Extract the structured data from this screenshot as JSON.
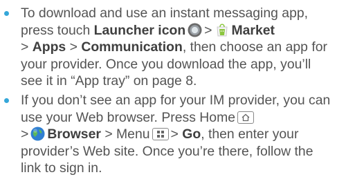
{
  "bullets": [
    {
      "l1": "To download and use an instant messaging app,",
      "l2_pre": "press touch",
      "launcher": "Launcher icon",
      "gt": ">",
      "market": "Market",
      "apps": "Apps",
      "communication": "Communication",
      "l3_post": ", then choose an app for",
      "l4": "your provider. Once you download the app, you’ll",
      "l5": "see it in “App tray” on page 8."
    },
    {
      "l1": "If you don’t see an app for your IM provider, you can",
      "l2_pre": "use your Web browser. Press Home",
      "browser": "Browser",
      "menu": "Menu",
      "go": "Go",
      "l3_post": ", then enter your",
      "l4": "provider’s Web site. Once you’re there, follow the",
      "l5": "link to sign in."
    }
  ],
  "colors": {
    "bullet": "#35a7d9",
    "text": "#545454",
    "bold": "#3f3f3f"
  },
  "icons": [
    "launcher-icon",
    "market-icon",
    "home-key-icon",
    "browser-icon",
    "menu-key-icon"
  ]
}
